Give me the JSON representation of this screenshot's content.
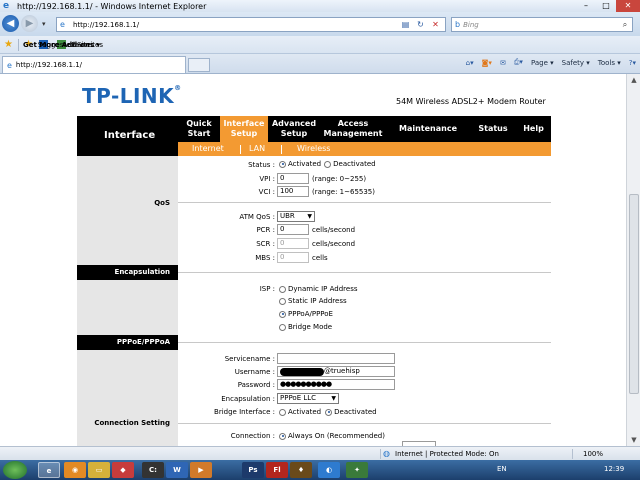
{
  "window": {
    "title": "http://192.168.1.1/ - Windows Internet Explorer",
    "minimize": "–",
    "maximize": "□",
    "close": "✕"
  },
  "addressbar": {
    "url": "http://192.168.1.1/",
    "search_placeholder": "Bing"
  },
  "favorites": {
    "label": "Favorites",
    "suggested": "Suggested Sites ▾",
    "addons": "Get More Add-ons ▾"
  },
  "tab": {
    "title": "http://192.168.1.1/"
  },
  "commands": {
    "page": "Page ▾",
    "safety": "Safety ▾",
    "tools": "Tools ▾",
    "help": "?▾"
  },
  "header": {
    "logo": "TP-LINK",
    "logo_mark": "®",
    "product": "54M Wireless ADSL2+ Modem Router"
  },
  "menu": {
    "section": "Interface",
    "items": [
      {
        "label": "Quick Start"
      },
      {
        "label": "Interface Setup"
      },
      {
        "label": "Advanced Setup"
      },
      {
        "label": "Access Management"
      },
      {
        "label": "Maintenance"
      },
      {
        "label": "Status"
      },
      {
        "label": "Help"
      }
    ],
    "sub": [
      "Internet",
      "LAN",
      "Wireless"
    ]
  },
  "form": {
    "qos_label": "QoS",
    "status_label": "Status :",
    "status_activated": "Activated",
    "status_deactivated": "Deactivated",
    "vpi_label": "VPI :",
    "vpi_value": "0",
    "vpi_range": "(range: 0~255)",
    "vci_label": "VCI :",
    "vci_value": "100",
    "vci_range": "(range: 1~65535)",
    "atmqos_label": "ATM QoS :",
    "atmqos_value": "UBR",
    "pcr_label": "PCR :",
    "pcr_value": "0",
    "pcr_unit": "cells/second",
    "scr_label": "SCR :",
    "scr_value": "0",
    "scr_unit": "cells/second",
    "mbs_label": "MBS :",
    "mbs_value": "0",
    "mbs_unit": "cells",
    "encap_header": "Encapsulation",
    "isp_label": "ISP :",
    "isp_options": [
      "Dynamic IP Address",
      "Static IP Address",
      "PPPoA/PPPoE",
      "Bridge Mode"
    ],
    "pppoe_header": "PPPoE/PPPoA",
    "servicename_label": "Servicename :",
    "servicename_value": "",
    "username_label": "Username :",
    "username_value": "@truehisp",
    "password_label": "Password :",
    "password_value": "●●●●●●●●●●",
    "encapsulation_label": "Encapsulation :",
    "encapsulation_value": "PPPoE LLC",
    "bridge_label": "Bridge Interface :",
    "bridge_activated": "Activated",
    "bridge_deactivated": "Deactivated",
    "connsetting_label": "Connection Setting",
    "connection_label": "Connection :",
    "connection_value": "Always On (Recommended)"
  },
  "statusbar": {
    "zone": "Internet | Protected Mode: On",
    "zoom": "100%"
  },
  "taskbar": {
    "lang": "EN",
    "time": "12:39"
  }
}
